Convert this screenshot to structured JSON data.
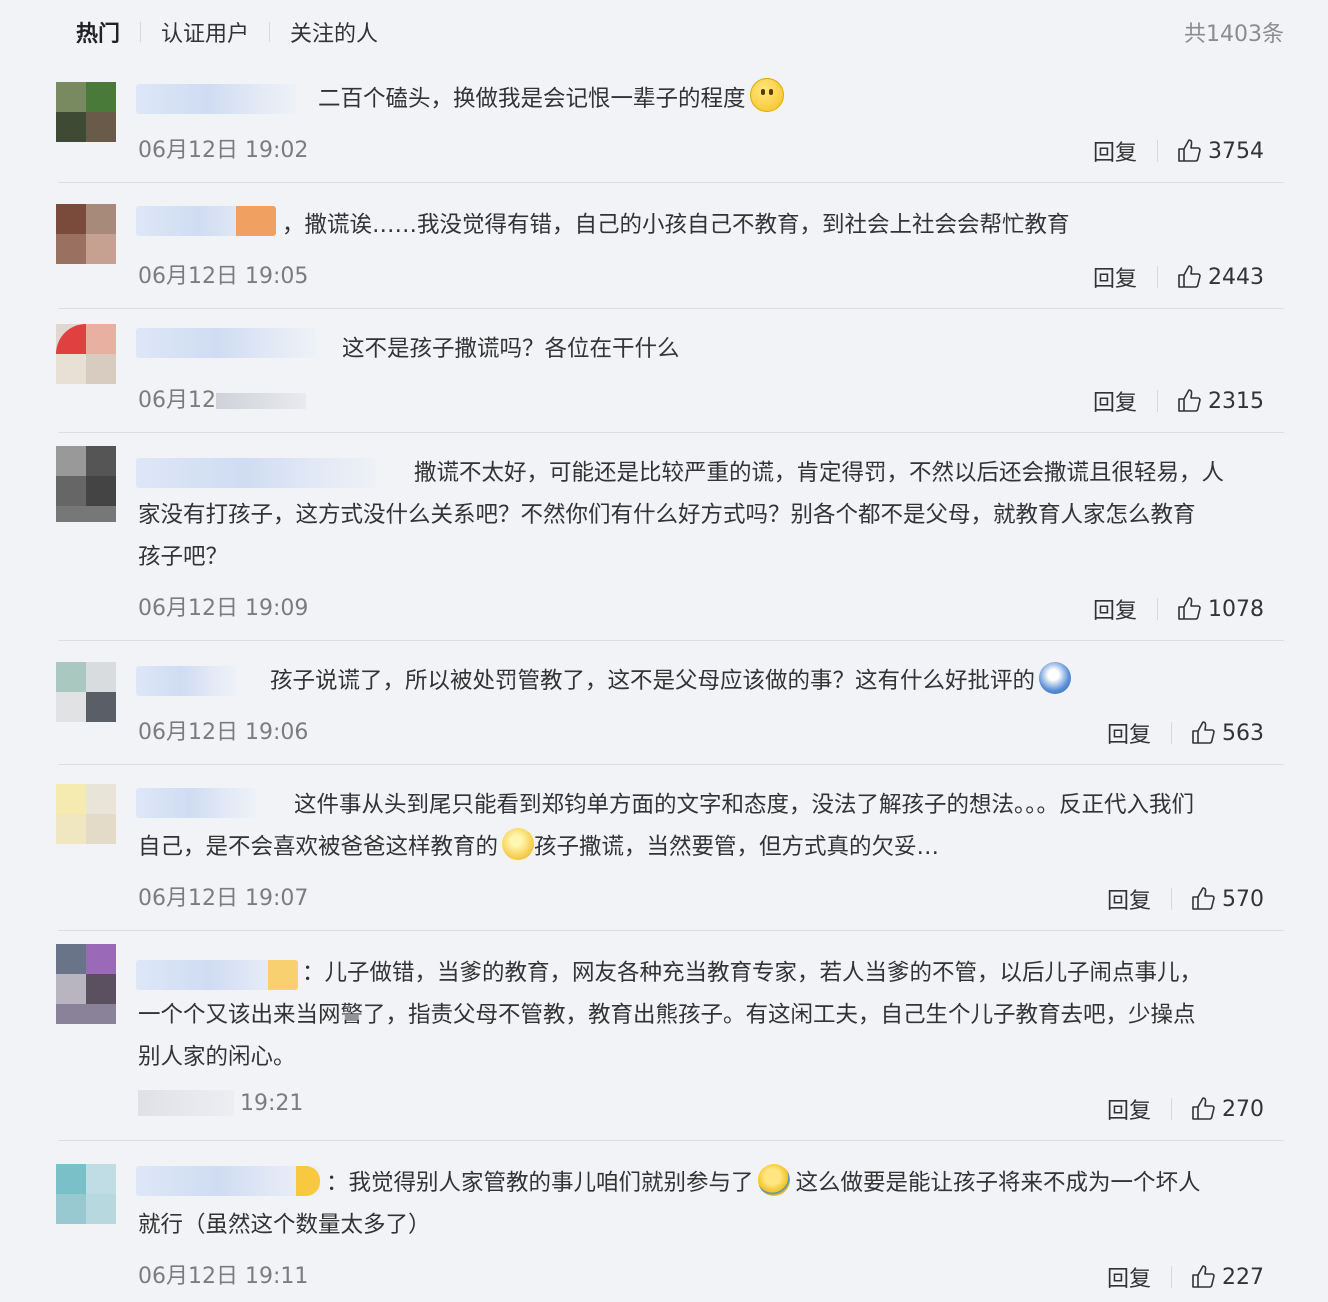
{
  "tabs": [
    {
      "label": "热门",
      "active": true
    },
    {
      "label": "认证用户",
      "active": false
    },
    {
      "label": "关注的人",
      "active": false
    }
  ],
  "total": "共1403条",
  "reply_label": "回复",
  "comments": [
    {
      "text_line1": "二百个磕头，换做我是会记恨一辈子的程度",
      "emoji": "smile-emoji",
      "time": "06月12日 19:02",
      "likes": "3754"
    },
    {
      "text_line1": "，撒谎诶……我没觉得有错，自己的小孩自己不教育，到社会上社会会帮忙教育",
      "time": "06月12日 19:05",
      "likes": "2443"
    },
    {
      "text_line1": "这不是孩子撒谎吗？各位在干什么",
      "time": "06月12",
      "likes": "2315"
    },
    {
      "text_line1": "撒谎不太好，可能还是比较严重的谎，肯定得罚，不然以后还会撒谎且很轻易，人",
      "text_line2": "家没有打孩子，这方式没什么关系吧？不然你们有什么好方式吗？别各个都不是父母，就教育人家怎么教育",
      "text_line3": "孩子吧？",
      "time": "06月12日 19:09",
      "likes": "1078"
    },
    {
      "text_line1": "孩子说谎了，所以被处罚管教了，这不是父母应该做的事？这有什么好批评的",
      "emoji": "doge-emoji",
      "time": "06月12日 19:06",
      "likes": "563"
    },
    {
      "text_line1": "这件事从头到尾只能看到郑钧单方面的文字和态度，没法了解孩子的想法。。。反正代入我们",
      "text_line2a": "自己，是不会喜欢被爸爸这样教育的",
      "emoji": "awkward-emoji",
      "text_line2b": "孩子撒谎，当然要管，但方式真的欠妥…",
      "time": "06月12日 19:07",
      "likes": "570"
    },
    {
      "text_line1": "：儿子做错，当爹的教育，网友各种充当教育专家，若人当爹的不管，以后儿子闹点事儿，",
      "text_line2": "一个个又该出来当网警了，指责父母不管教，教育出熊孩子。有这闲工夫，自己生个儿子教育去吧，少操点",
      "text_line3": "别人家的闲心。",
      "time": "19:21",
      "likes": "270"
    },
    {
      "text_line1a": "：我觉得别人家管教的事儿咱们就别参与了",
      "emoji": "laugh-cry-emoji",
      "text_line1b": "这么做要是能让孩子将来不成为一个坏人",
      "text_line2": "就行（虽然这个数量太多了）",
      "time": "06月12日 19:11",
      "likes": "227"
    }
  ]
}
